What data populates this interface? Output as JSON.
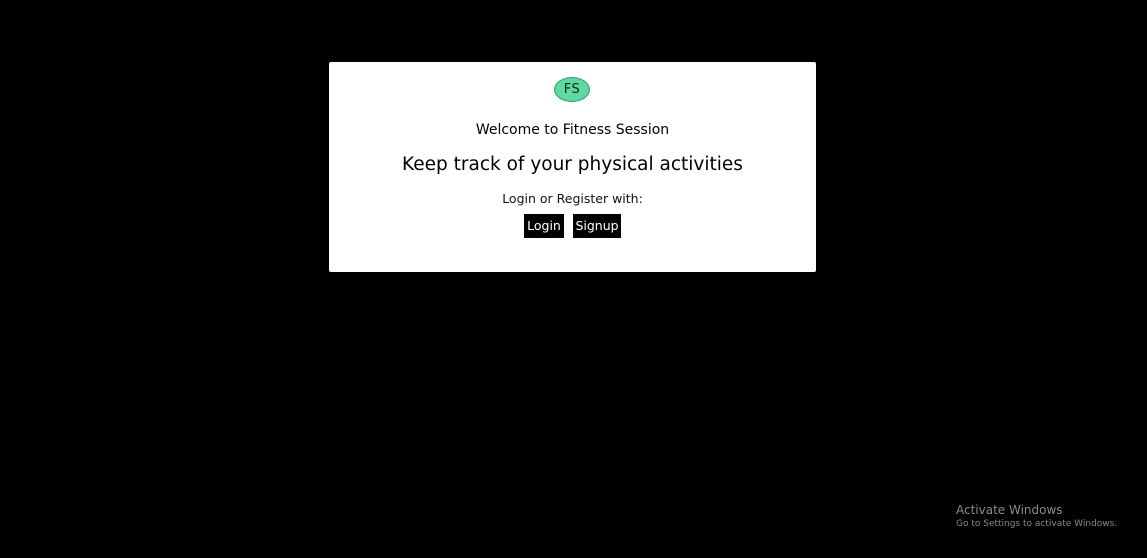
{
  "app": {
    "logo_text": "FS",
    "welcome": "Welcome to Fitness Session",
    "headline": "Keep track of your physical activities",
    "prompt": "Login or Register with:",
    "login_label": "Login",
    "signup_label": "Signup"
  },
  "os_watermark": {
    "title": "Activate Windows",
    "subtitle": "Go to Settings to activate Windows."
  },
  "colors": {
    "background": "#000000",
    "card": "#ffffff",
    "logo_fill": "#5fd8a2",
    "button": "#000000"
  }
}
